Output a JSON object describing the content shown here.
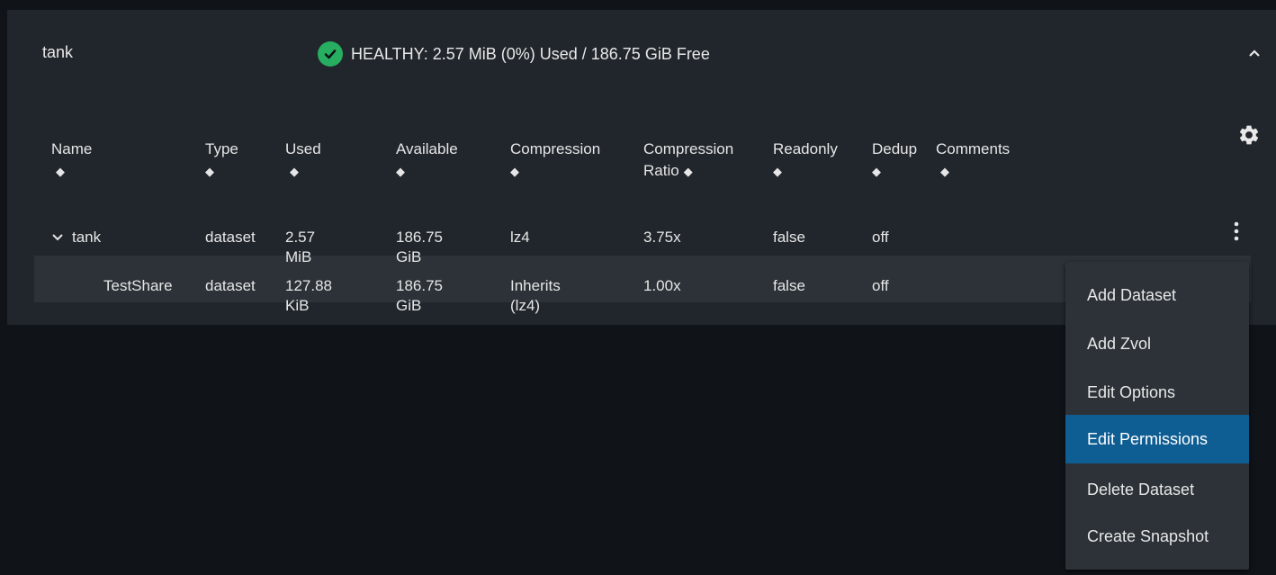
{
  "pool": {
    "name": "tank",
    "status": "HEALTHY: 2.57 MiB (0%) Used / 186.75 GiB Free"
  },
  "table": {
    "columns": [
      {
        "line1": "Name",
        "line2": ""
      },
      {
        "line1": "Type",
        "line2": ""
      },
      {
        "line1": "Used",
        "line2": ""
      },
      {
        "line1": "Available",
        "line2": ""
      },
      {
        "line1": "Compression",
        "line2": ""
      },
      {
        "line1": "Compression",
        "line2": "Ratio"
      },
      {
        "line1": "Readonly",
        "line2": ""
      },
      {
        "line1": "Dedup",
        "line2": ""
      },
      {
        "line1": "Comments",
        "line2": ""
      }
    ],
    "rows": [
      {
        "name": "tank",
        "type": "dataset",
        "used": "2.57 MiB",
        "available": "186.75 GiB",
        "compression": "lz4",
        "ratio": "3.75x",
        "readonly": "false",
        "dedup": "off",
        "comments": ""
      },
      {
        "name": "TestShare",
        "type": "dataset",
        "used": "127.88 KiB",
        "available": "186.75 GiB",
        "compression": "Inherits (lz4)",
        "ratio": "1.00x",
        "readonly": "false",
        "dedup": "off",
        "comments": ""
      }
    ]
  },
  "menu": {
    "items": [
      {
        "label": "Add Dataset",
        "active": false
      },
      {
        "label": "Add Zvol",
        "active": false
      },
      {
        "label": "Edit Options",
        "active": false
      },
      {
        "label": "Edit Permissions",
        "active": true
      },
      {
        "label": "Delete Dataset",
        "active": false
      },
      {
        "label": "Create Snapshot",
        "active": false
      }
    ]
  },
  "colors": {
    "background": "#101418",
    "card": "#21262c",
    "healthy": "#27ae60",
    "menu_active": "#0e5d93"
  },
  "icons": {
    "health": "check-circle-icon",
    "collapse": "chevron-up-icon",
    "settings": "gear-icon",
    "actions": "more-vertical-icon",
    "expand": "chevron-down-icon",
    "sort": "sort-icon"
  }
}
